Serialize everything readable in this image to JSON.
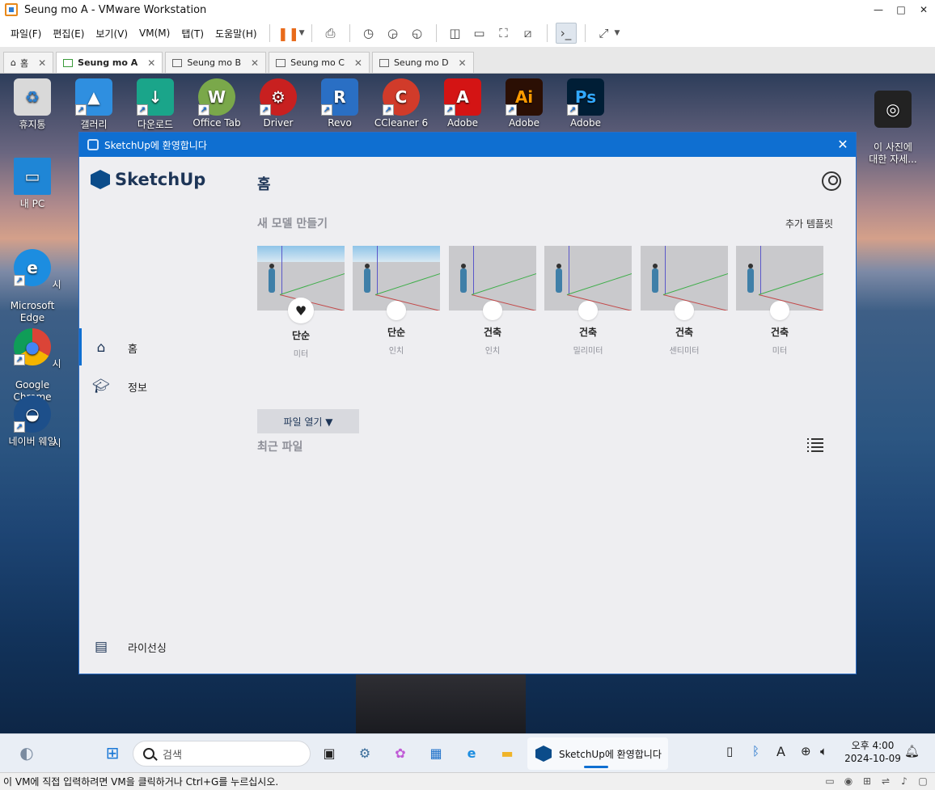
{
  "vmware": {
    "title": "Seung mo A - VMware Workstation",
    "window_controls": {
      "minimize": "—",
      "maximize": "□",
      "close": "✕"
    },
    "menu": [
      "파일(F)",
      "편집(E)",
      "보기(V)",
      "VM(M)",
      "탭(T)",
      "도움말(H)"
    ],
    "tabs": [
      {
        "label": "홈",
        "active": false
      },
      {
        "label": "Seung mo A",
        "active": true
      },
      {
        "label": "Seung mo B",
        "active": false
      },
      {
        "label": "Seung mo C",
        "active": false
      },
      {
        "label": "Seung mo D",
        "active": false
      }
    ],
    "status": "이 VM에 직접 입력하려면 VM을 클릭하거나 Ctrl+G를 누르십시오."
  },
  "desktop": {
    "icons": [
      {
        "label": "휴지통",
        "color": "#d9d9d9",
        "glyph": "♻"
      },
      {
        "label": "갤러리",
        "color": "#2f8fe0",
        "glyph": "▲"
      },
      {
        "label": "다운로드",
        "color": "#1aa58a",
        "glyph": "↓"
      },
      {
        "label": "Office Tab",
        "color": "#7aa84a",
        "glyph": "W"
      },
      {
        "label": "Driver",
        "color": "#c82020",
        "glyph": "⚙"
      },
      {
        "label": "Revo",
        "color": "#2a6fc4",
        "glyph": "R"
      },
      {
        "label": "CCleaner 6",
        "color": "#d13b2a",
        "glyph": "C"
      },
      {
        "label": "Adobe",
        "color": "#d41414",
        "glyph": "A"
      },
      {
        "label": "Adobe",
        "color": "#2b0f04",
        "glyph": "Ai"
      },
      {
        "label": "Adobe",
        "color": "#001e36",
        "glyph": "Ps"
      },
      {
        "label": "이 사진에\n대한 자세...",
        "color": "#222222",
        "glyph": "◎"
      },
      {
        "label": "내 PC",
        "color": "#1f86d6",
        "glyph": "▭"
      },
      {
        "label": "Microsoft\nEdge",
        "color": "#1c8de0",
        "glyph": "e"
      },
      {
        "label": "Google\nChrome",
        "color": "#e8e8e8",
        "glyph": "●"
      },
      {
        "label": "네이버 웨일",
        "color": "#1d4f8a",
        "glyph": "◒"
      }
    ],
    "partial_labels": [
      "시",
      "시",
      "시"
    ]
  },
  "sketchup": {
    "window_title": "SketchUp에 환영합니다",
    "brand": "SketchUp",
    "nav": [
      {
        "label": "홈"
      },
      {
        "label": "정보"
      },
      {
        "label": "라이선싱"
      }
    ],
    "heading": "홈",
    "new_model_title": "새 모델 만들기",
    "more_templates": "추가 템플릿",
    "templates": [
      {
        "name": "단순",
        "unit": "미터",
        "favorite": true,
        "sky": true
      },
      {
        "name": "단순",
        "unit": "인치",
        "favorite": false,
        "sky": true
      },
      {
        "name": "건축",
        "unit": "인치",
        "favorite": false,
        "sky": false
      },
      {
        "name": "건축",
        "unit": "밀리미터",
        "favorite": false,
        "sky": false
      },
      {
        "name": "건축",
        "unit": "센티미터",
        "favorite": false,
        "sky": false
      },
      {
        "name": "건축",
        "unit": "미터",
        "favorite": false,
        "sky": false
      }
    ],
    "open_file": "파일 열기 ▼",
    "recent_files": "최근 파일"
  },
  "taskbar": {
    "search_placeholder": "검색",
    "active_app": "SketchUp에 환영합니다",
    "time": "오후 4:00",
    "date": "2024-10-09",
    "ime": "A"
  }
}
